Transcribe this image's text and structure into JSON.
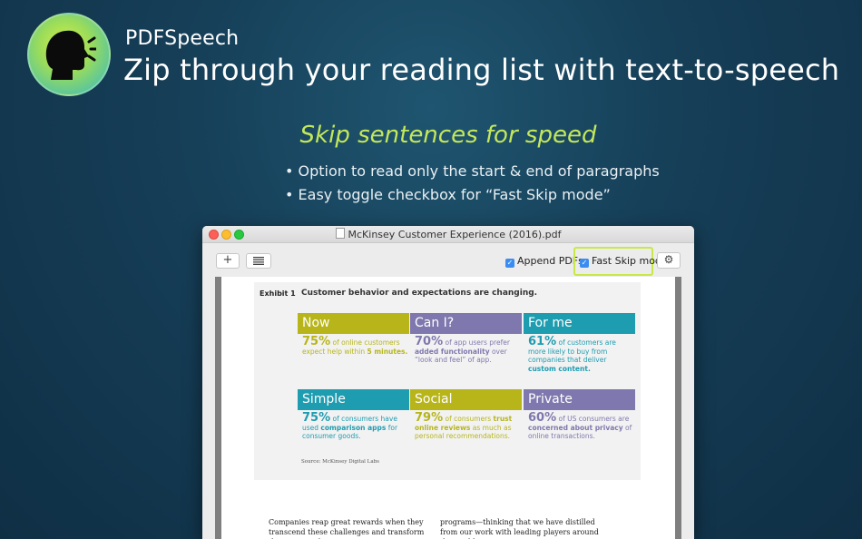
{
  "header": {
    "app_name": "PDFSpeech",
    "tagline": "Zip through your reading list with text-to-speech",
    "icon": "speaking-head-icon"
  },
  "feature": {
    "title": "Skip sentences for speed",
    "bullets": [
      "• Option to read only the start & end of paragraphs",
      "• Easy toggle checkbox for “Fast Skip mode”"
    ]
  },
  "window": {
    "title": "McKinsey Customer Experience (2016).pdf",
    "toolbar": {
      "add_label": "+",
      "list_icon": "list-icon",
      "append_label": "Append PDFs",
      "append_checked": true,
      "fast_skip_label": "Fast Skip mode",
      "fast_skip_checked": true,
      "settings_icon": "gear-icon"
    }
  },
  "document": {
    "exhibit_label": "Exhibit 1",
    "exhibit_title": "Customer behavior and expectations are changing.",
    "source": "Source: McKinsey Digital Labs",
    "cells": [
      {
        "header": "Now",
        "stat": "75%",
        "text_a": " of online customers expect help within ",
        "emph": "5 minutes.",
        "text_b": "",
        "color": "#b7b51a"
      },
      {
        "header": "Can I?",
        "stat": "70%",
        "text_a": " of app users prefer ",
        "emph": "added functionality",
        "text_b": " over “look and feel” of app.",
        "color": "#7f78ae"
      },
      {
        "header": "For me",
        "stat": "61%",
        "text_a": " of customers are more likely to buy from companies that deliver ",
        "emph": "custom content.",
        "text_b": "",
        "color": "#1e9cb0"
      },
      {
        "header": "Simple",
        "stat": "75%",
        "text_a": " of consumers have used ",
        "emph": "comparison apps",
        "text_b": " for consumer goods.",
        "color": "#1e9cb0"
      },
      {
        "header": "Social",
        "stat": "79%",
        "text_a": " of consumers ",
        "emph": "trust online reviews",
        "text_b": " as much as personal recommendations.",
        "color": "#b7b51a"
      },
      {
        "header": "Private",
        "stat": "60%",
        "text_a": " of US consumers are ",
        "emph": "concerned about privacy",
        "text_b": " of online transactions.",
        "color": "#7f78ae"
      }
    ],
    "body_left": "Companies reap great rewards when they transcend these challenges and transform their approach so",
    "body_right": "programs—thinking that we have distilled from our work with leading players around the world."
  }
}
